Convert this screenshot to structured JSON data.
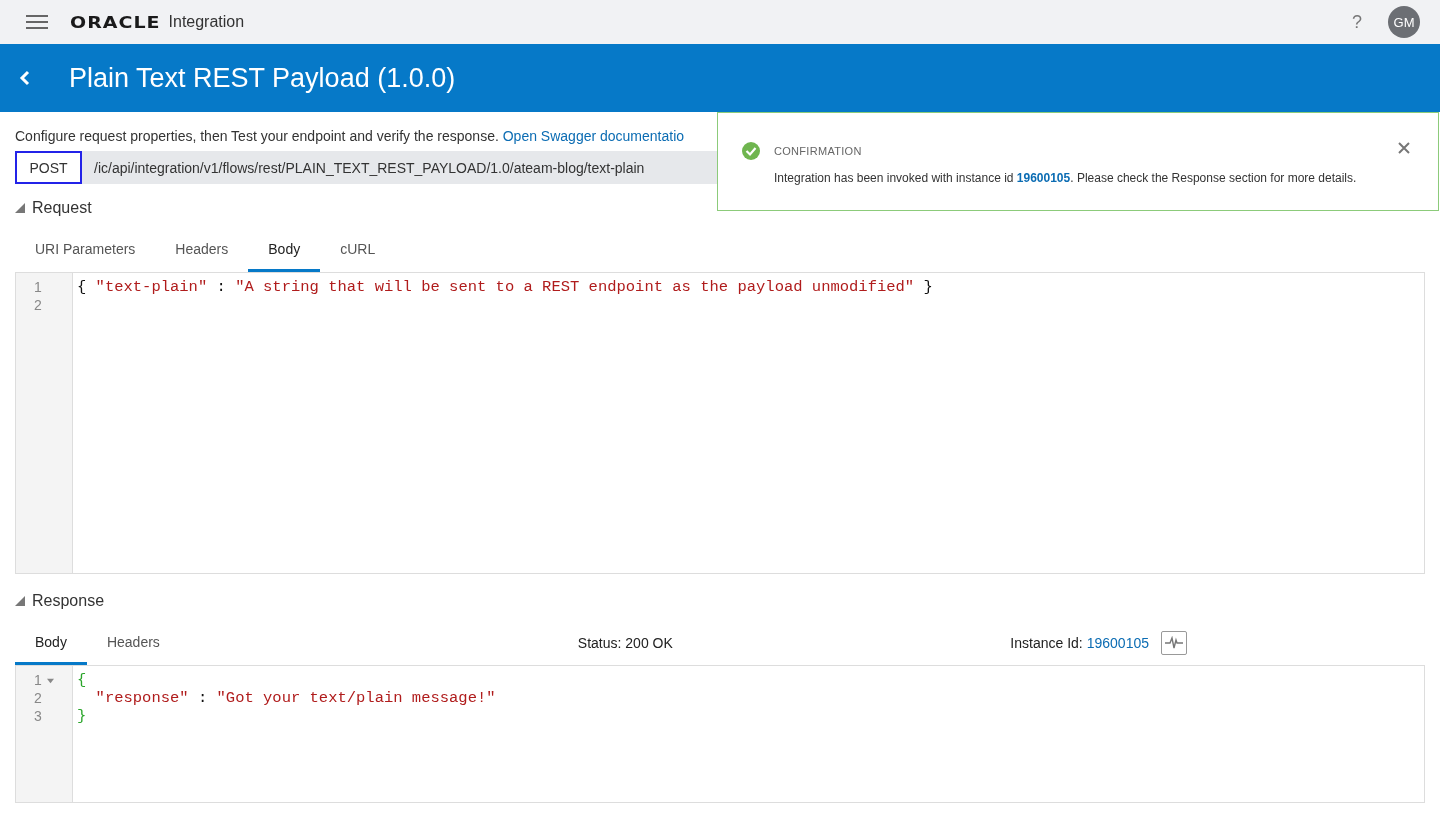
{
  "header": {
    "logo": "ORACLE",
    "product": "Integration",
    "help": "?",
    "avatar": "GM"
  },
  "title_bar": {
    "title": "Plain Text REST Payload (1.0.0)"
  },
  "description": {
    "text": "Configure request properties, then Test your endpoint and verify the response.",
    "link": "Open Swagger documentatio"
  },
  "endpoint": {
    "method": "POST",
    "url": "/ic/api/integration/v1/flows/rest/PLAIN_TEXT_REST_PAYLOAD/1.0/ateam-blog/text-plain"
  },
  "request": {
    "title": "Request",
    "expanded": true,
    "tabs": [
      {
        "label": "URI Parameters",
        "selected": false
      },
      {
        "label": "Headers",
        "selected": false
      },
      {
        "label": "Body",
        "selected": true
      },
      {
        "label": "cURL",
        "selected": false
      }
    ],
    "editor": {
      "lines": [
        {
          "number": "1",
          "segments": [
            {
              "kind": "punct",
              "text": "{ "
            },
            {
              "kind": "string",
              "text": "\"text-plain\""
            },
            {
              "kind": "punct",
              "text": " : "
            },
            {
              "kind": "string",
              "text": "\"A string that will be sent to a REST endpoint as the payload unmodified\""
            },
            {
              "kind": "punct",
              "text": " }"
            }
          ]
        },
        {
          "number": "2"
        }
      ]
    }
  },
  "response": {
    "title": "Response",
    "expanded": true,
    "tabs": [
      {
        "label": "Body",
        "selected": true
      },
      {
        "label": "Headers",
        "selected": false
      }
    ],
    "status_label": "Status:",
    "status": "200 OK",
    "instance_label": "Instance Id:",
    "instance_id": "19600105",
    "editor": {
      "lines": [
        {
          "number": "1",
          "expanded": true,
          "segments": [
            {
              "kind": "brace",
              "text": "{"
            }
          ]
        },
        {
          "number": "2",
          "segments": [
            {
              "kind": "string",
              "text": "  \"response\""
            },
            {
              "kind": "punct",
              "text": " : "
            },
            {
              "kind": "string",
              "text": "\"Got your text/plain message!\""
            }
          ]
        },
        {
          "number": "3",
          "segments": [
            {
              "kind": "brace",
              "text": "}"
            }
          ]
        }
      ]
    }
  },
  "toast": {
    "heading": "CONFIRMATION",
    "message": "Integration has been invoked with instance id **19600105**. Please check the Response section for more details."
  }
}
